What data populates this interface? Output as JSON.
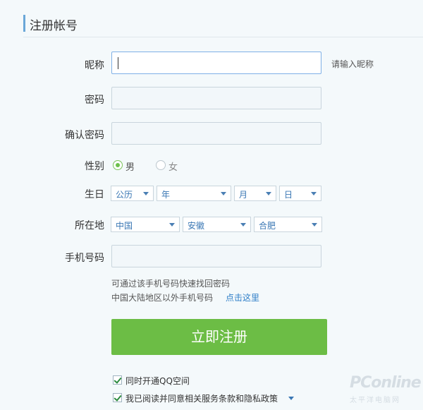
{
  "header": {
    "title": "注册帐号"
  },
  "nickname": {
    "label": "昵称",
    "value": "",
    "hint": "请输入昵称"
  },
  "password": {
    "label": "密码",
    "value": ""
  },
  "confirm": {
    "label": "确认密码",
    "value": ""
  },
  "gender": {
    "label": "性别",
    "male": "男",
    "female": "女",
    "selected": "男"
  },
  "birthday": {
    "label": "生日",
    "calendar": "公历",
    "year": "年",
    "month": "月",
    "day": "日"
  },
  "location": {
    "label": "所在地",
    "country": "中国",
    "province": "安徽",
    "city": "合肥"
  },
  "phone": {
    "label": "手机号码",
    "value": "",
    "note1": "可通过该手机号码快速找回密码",
    "note2": "中国大陆地区以外手机号码",
    "link": "点击这里"
  },
  "submit": {
    "label": "立即注册"
  },
  "agreements": [
    {
      "label": "同时开通QQ空间",
      "checked": true
    },
    {
      "label": "我已阅读并同意相关服务条款和隐私政策",
      "checked": true
    }
  ],
  "watermark": {
    "logo": "PConline",
    "sub": "太平洋电脑网"
  },
  "colors": {
    "accent": "#6cbd45",
    "link": "#2f7fc8",
    "header_bar": "#6aa7d8"
  }
}
